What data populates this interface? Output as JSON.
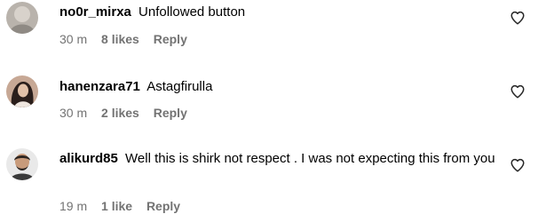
{
  "comments": [
    {
      "username": "no0r_mirxa",
      "text": "Unfollowed button",
      "time": "30 m",
      "likes": "8 likes",
      "reply": "Reply"
    },
    {
      "username": "hanenzara71",
      "text": "Astagfirulla",
      "time": "30 m",
      "likes": "2 likes",
      "reply": "Reply"
    },
    {
      "username": "alikurd85",
      "text": "Well this is shirk not respect . I was not expecting this from you",
      "time": "19 m",
      "likes": "1 like",
      "reply": "Reply"
    }
  ],
  "icons": {
    "like": "heart-outline-icon"
  },
  "colors": {
    "text": "#000000",
    "meta": "#737373"
  }
}
